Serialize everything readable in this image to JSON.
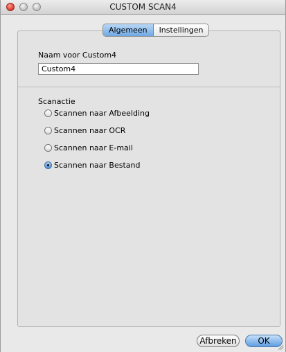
{
  "window": {
    "title": "CUSTOM SCAN4"
  },
  "tabs": [
    {
      "label": "Algemeen",
      "active": true
    },
    {
      "label": "Instellingen",
      "active": false
    }
  ],
  "name_section": {
    "label": "Naam voor Custom4",
    "value": "Custom4"
  },
  "scan_action": {
    "label": "Scanactie",
    "options": [
      {
        "label": "Scannen naar Afbeelding",
        "selected": false
      },
      {
        "label": "Scannen naar OCR",
        "selected": false
      },
      {
        "label": "Scannen naar E-mail",
        "selected": false
      },
      {
        "label": "Scannen naar Bestand",
        "selected": true
      }
    ]
  },
  "buttons": {
    "cancel": "Afbreken",
    "ok": "OK"
  },
  "colors": {
    "accent": "#6fa9e3",
    "close": "#d8382e"
  }
}
